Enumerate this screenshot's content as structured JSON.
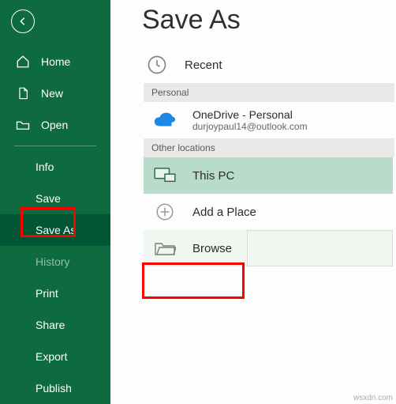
{
  "sidebar": {
    "home": "Home",
    "new": "New",
    "open": "Open",
    "info": "Info",
    "save": "Save",
    "saveAs": "Save As",
    "history": "History",
    "print": "Print",
    "share": "Share",
    "export": "Export",
    "publish": "Publish"
  },
  "page": {
    "title": "Save As",
    "recent": "Recent",
    "section_personal": "Personal",
    "onedrive_name": "OneDrive - Personal",
    "onedrive_email": "durjoypaul14@outlook.com",
    "section_other": "Other locations",
    "this_pc": "This PC",
    "add_place": "Add a Place",
    "browse": "Browse"
  },
  "watermark": "wsxdn.com"
}
